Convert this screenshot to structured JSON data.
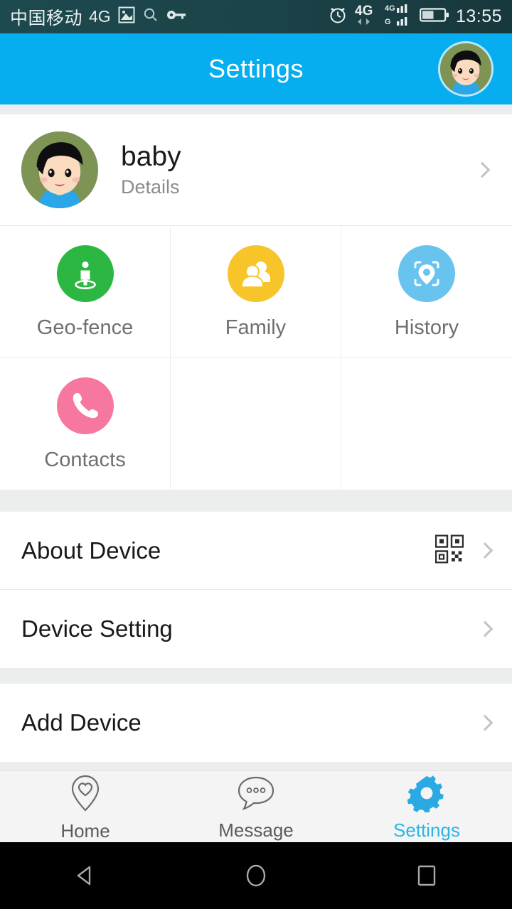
{
  "status_bar": {
    "carrier": "中国移动",
    "network": "4G",
    "time": "13:55",
    "left_icons": [
      "photo-icon",
      "search-icon",
      "key-icon"
    ],
    "right_icons": [
      "alarm-icon",
      "4g-data-icon",
      "dual-signal-icon",
      "battery-icon"
    ],
    "background": "#1b4247",
    "text_color": "#e9f0f0"
  },
  "app_bar": {
    "title": "Settings",
    "avatar": "child-avatar",
    "background": "#06aef0",
    "title_color": "#ffffff"
  },
  "profile": {
    "name": "baby",
    "subtitle": "Details",
    "avatar": "child-avatar",
    "chevron": "chevron-right-icon"
  },
  "tiles": [
    {
      "label": "Geo-fence",
      "icon": "geo-fence-icon",
      "color": "#2cb742",
      "empty": false
    },
    {
      "label": "Family",
      "icon": "family-icon",
      "color": "#f7c52a",
      "empty": false
    },
    {
      "label": "History",
      "icon": "history-location-icon",
      "color": "#68c3ee",
      "empty": false
    },
    {
      "label": "Contacts",
      "icon": "phone-icon",
      "color": "#f7789f",
      "empty": false
    },
    {
      "label": "",
      "icon": "",
      "color": "",
      "empty": true
    },
    {
      "label": "",
      "icon": "",
      "color": "",
      "empty": true
    }
  ],
  "settings_group_1": [
    {
      "label": "About Device",
      "accessory": "qr-code-icon",
      "chevron": "chevron-right-icon"
    },
    {
      "label": "Device Setting",
      "accessory": "",
      "chevron": "chevron-right-icon"
    }
  ],
  "settings_group_2": [
    {
      "label": "Add Device",
      "accessory": "",
      "chevron": "chevron-right-icon"
    }
  ],
  "tab_bar": [
    {
      "label": "Home",
      "icon": "home-pin-heart-icon",
      "active": false
    },
    {
      "label": "Message",
      "icon": "message-bubble-icon",
      "active": false
    },
    {
      "label": "Settings",
      "icon": "gear-icon",
      "active": true
    }
  ],
  "nav_bar": {
    "back": "back-triangle-icon",
    "home": "home-circle-icon",
    "recents": "recents-square-icon"
  },
  "theme": {
    "accent": "#06aef0",
    "tab_active": "#29b6ea",
    "page_bg": "#eceded",
    "card_bg": "#ffffff"
  }
}
